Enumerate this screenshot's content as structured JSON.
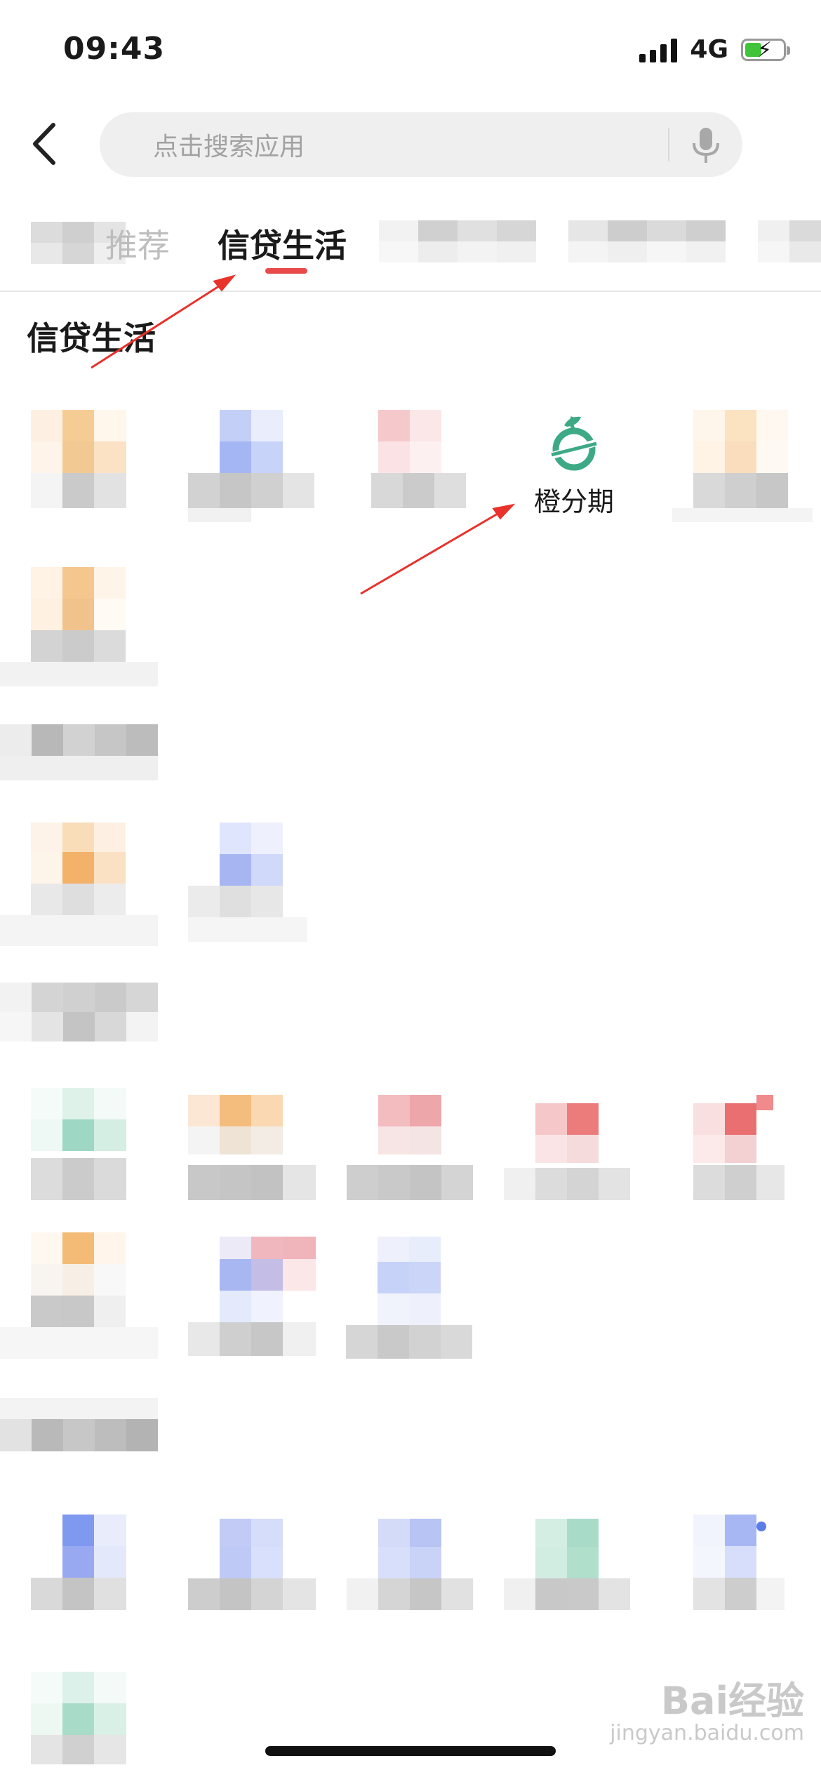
{
  "status_bar": {
    "time": "09:43",
    "network": "4G"
  },
  "search": {
    "placeholder": "点击搜索应用"
  },
  "tabs": [
    {
      "label": "推荐",
      "active": false
    },
    {
      "label": "信贷生活",
      "active": true
    }
  ],
  "section": {
    "title": "信贷生活"
  },
  "featured_app": {
    "label": "橙分期",
    "icon": "orange-installment-icon",
    "color": "#3daa85"
  },
  "accent_color": "#e94b4b",
  "watermark": {
    "brand": "Bai经验",
    "site": "jingyan.baidu.com"
  }
}
